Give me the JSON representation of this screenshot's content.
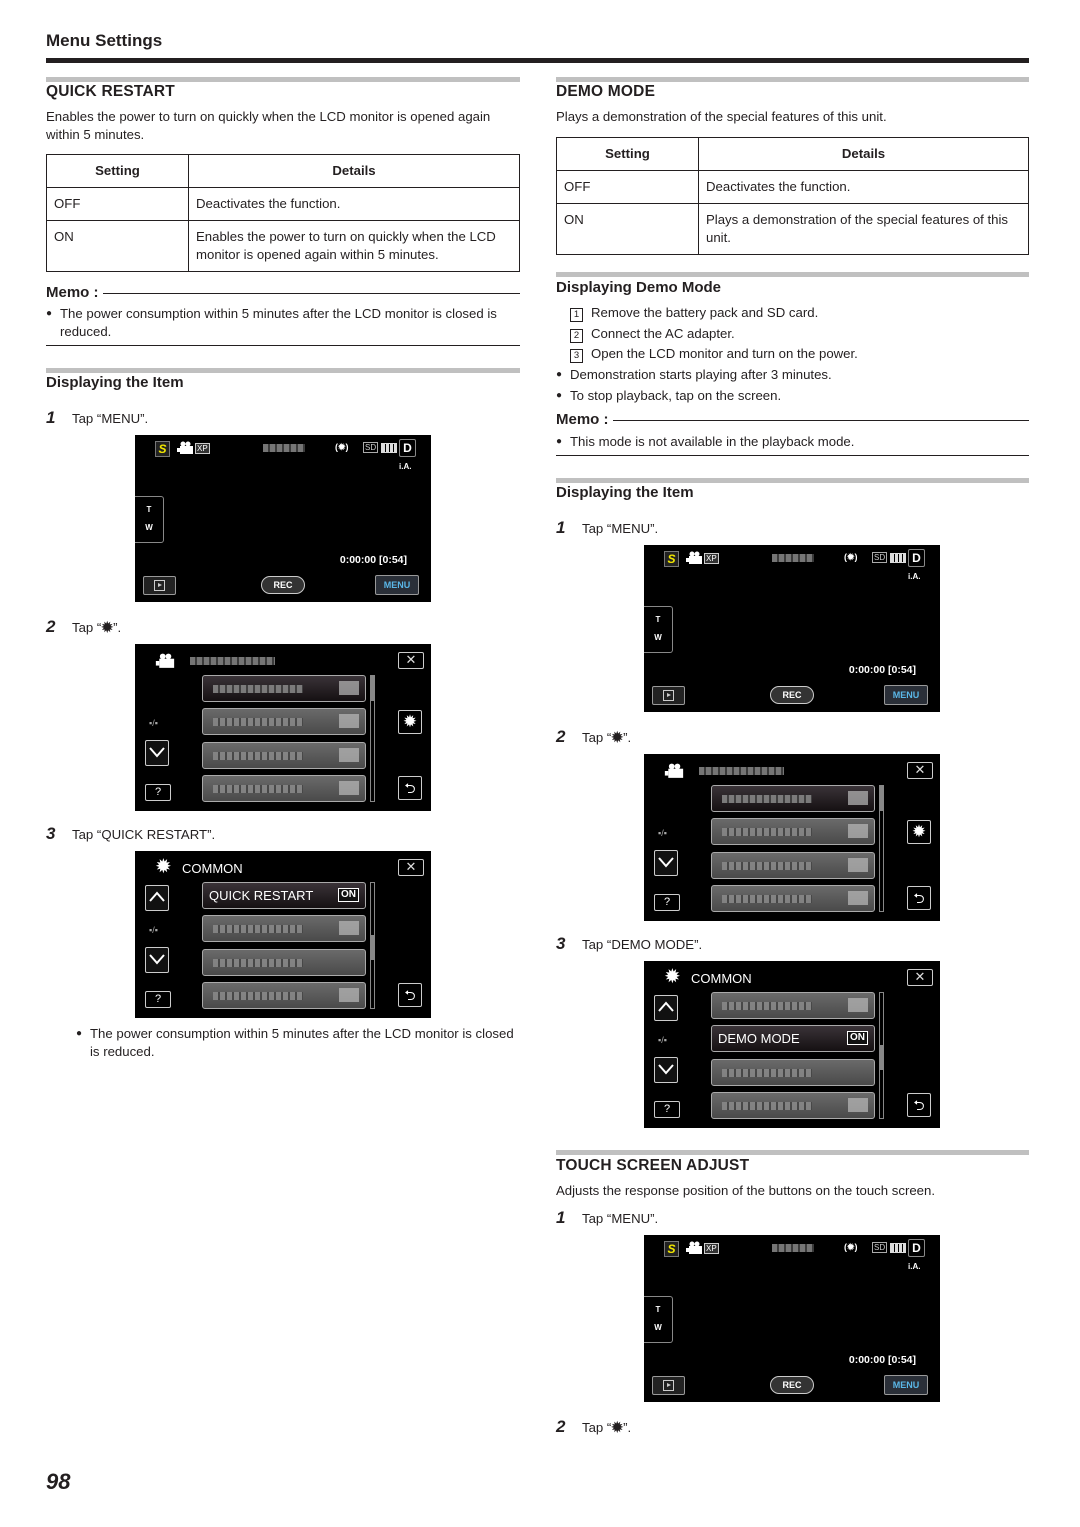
{
  "header": {
    "title": "Menu Settings"
  },
  "page_number": "98",
  "quick_restart": {
    "title": "QUICK RESTART",
    "description": "Enables the power to turn on quickly when the LCD monitor is opened again within 5 minutes.",
    "table": {
      "headers": [
        "Setting",
        "Details"
      ],
      "rows": [
        [
          "OFF",
          "Deactivates the function."
        ],
        [
          "ON",
          "Enables the power to turn on quickly when the LCD monitor is opened again within 5 minutes."
        ]
      ]
    },
    "memo": {
      "label": "Memo :",
      "items": [
        "The power consumption within 5 minutes after the LCD monitor is closed is reduced."
      ]
    },
    "displaying": {
      "title": "Displaying the Item",
      "steps": [
        {
          "num": "1",
          "text": "Tap “MENU”."
        },
        {
          "num": "2",
          "text_before": "Tap “",
          "icon": "gear-icon",
          "text_after": "”."
        },
        {
          "num": "3",
          "text": "Tap “QUICK RESTART”."
        }
      ],
      "note": "The power consumption within 5 minutes after the LCD monitor is closed is reduced.",
      "selected_item": "QUICK RESTART",
      "selected_value": "ON"
    }
  },
  "demo_mode": {
    "title": "DEMO MODE",
    "description": "Plays a demonstration of the special features of this unit.",
    "table": {
      "headers": [
        "Setting",
        "Details"
      ],
      "rows": [
        [
          "OFF",
          "Deactivates the function."
        ],
        [
          "ON",
          "Plays a demonstration of the special features of this unit."
        ]
      ]
    },
    "displaying_demo": {
      "title": "Displaying Demo Mode",
      "numbered": [
        {
          "num": "1",
          "text": "Remove the battery pack and SD card."
        },
        {
          "num": "2",
          "text": "Connect the AC adapter."
        },
        {
          "num": "3",
          "text": "Open the LCD monitor and turn on the power."
        }
      ],
      "bullets": [
        "Demonstration starts playing after 3 minutes.",
        "To stop playback, tap on the screen."
      ]
    },
    "memo": {
      "label": "Memo :",
      "items": [
        "This mode is not available in the playback mode."
      ]
    },
    "displaying": {
      "title": "Displaying the Item",
      "steps": [
        {
          "num": "1",
          "text": "Tap “MENU”."
        },
        {
          "num": "2",
          "text_before": "Tap “",
          "icon": "gear-icon",
          "text_after": "”."
        },
        {
          "num": "3",
          "text": "Tap “DEMO MODE”."
        }
      ],
      "selected_item": "DEMO MODE",
      "selected_value": "ON"
    }
  },
  "touch_screen_adjust": {
    "title": "TOUCH SCREEN ADJUST",
    "description": "Adjusts the response position of the buttons on the touch screen.",
    "steps": [
      {
        "num": "1",
        "text": "Tap “MENU”."
      },
      {
        "num": "2",
        "text_before": "Tap “",
        "icon": "gear-icon",
        "text_after": "”."
      }
    ]
  },
  "camera_screen": {
    "mode_badge": "S",
    "quality": "XP",
    "stabilizer": "(✹)",
    "media": "SD",
    "d_button": "D",
    "ia_label": "i.A.",
    "zoom_t": "T",
    "zoom_w": "W",
    "counter": "0:00:00  [0:54]",
    "rec_label": "REC",
    "menu_label": "MENU",
    "colors": {
      "mode_badge": "#f1e600",
      "menu_text": "#5ab7e8"
    }
  },
  "menu_screen": {
    "common_label": "COMMON",
    "close_glyph": "✕",
    "help_glyph": "?",
    "gear_glyph": "✹",
    "back_glyph": "⮌"
  }
}
